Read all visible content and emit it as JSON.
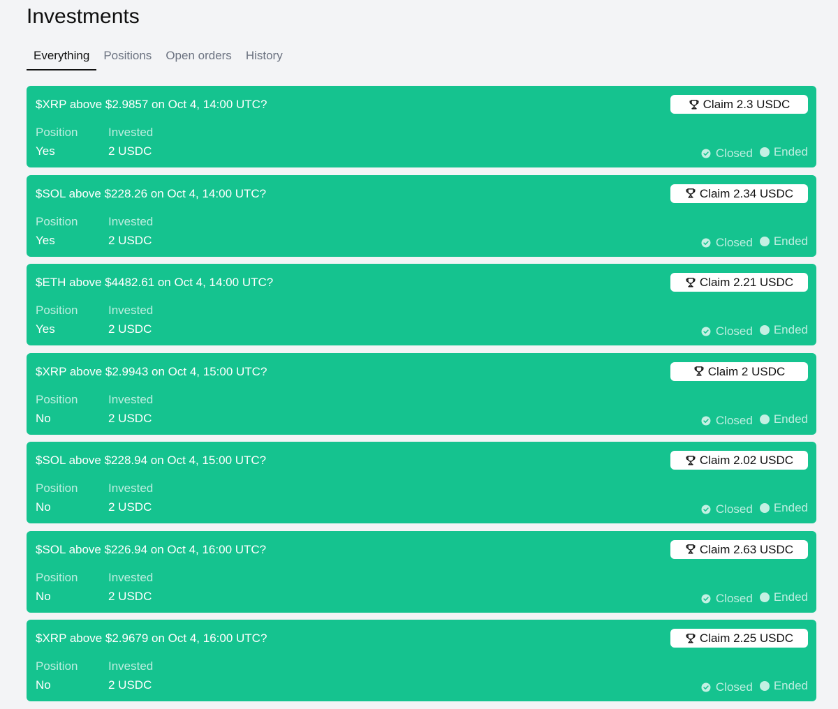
{
  "page": {
    "title": "Investments"
  },
  "tabs": [
    {
      "label": "Everything",
      "active": true
    },
    {
      "label": "Positions",
      "active": false
    },
    {
      "label": "Open orders",
      "active": false
    },
    {
      "label": "History",
      "active": false
    }
  ],
  "labels": {
    "position": "Position",
    "invested": "Invested",
    "closed": "Closed",
    "ended": "Ended"
  },
  "icons": {
    "claim": "trophy-icon",
    "closed": "check-circle-icon",
    "ended": "dot-icon"
  },
  "colors": {
    "card_background": "#15c38f",
    "page_background": "#f3f4f6",
    "button_background": "#ffffff"
  },
  "cards": [
    {
      "title": "$XRP above $2.9857 on Oct 4, 14:00 UTC?",
      "position": "Yes",
      "invested": "2 USDC",
      "claim": "Claim 2.3 USDC"
    },
    {
      "title": "$SOL above $228.26 on Oct 4, 14:00 UTC?",
      "position": "Yes",
      "invested": "2 USDC",
      "claim": "Claim 2.34 USDC"
    },
    {
      "title": "$ETH above $4482.61 on Oct 4, 14:00 UTC?",
      "position": "Yes",
      "invested": "2 USDC",
      "claim": "Claim 2.21 USDC"
    },
    {
      "title": "$XRP above $2.9943 on Oct 4, 15:00 UTC?",
      "position": "No",
      "invested": "2 USDC",
      "claim": "Claim 2 USDC"
    },
    {
      "title": "$SOL above $228.94 on Oct 4, 15:00 UTC?",
      "position": "No",
      "invested": "2 USDC",
      "claim": "Claim 2.02 USDC"
    },
    {
      "title": "$SOL above $226.94 on Oct 4, 16:00 UTC?",
      "position": "No",
      "invested": "2 USDC",
      "claim": "Claim 2.63 USDC"
    },
    {
      "title": "$XRP above $2.9679 on Oct 4, 16:00 UTC?",
      "position": "No",
      "invested": "2 USDC",
      "claim": "Claim 2.25 USDC"
    }
  ]
}
